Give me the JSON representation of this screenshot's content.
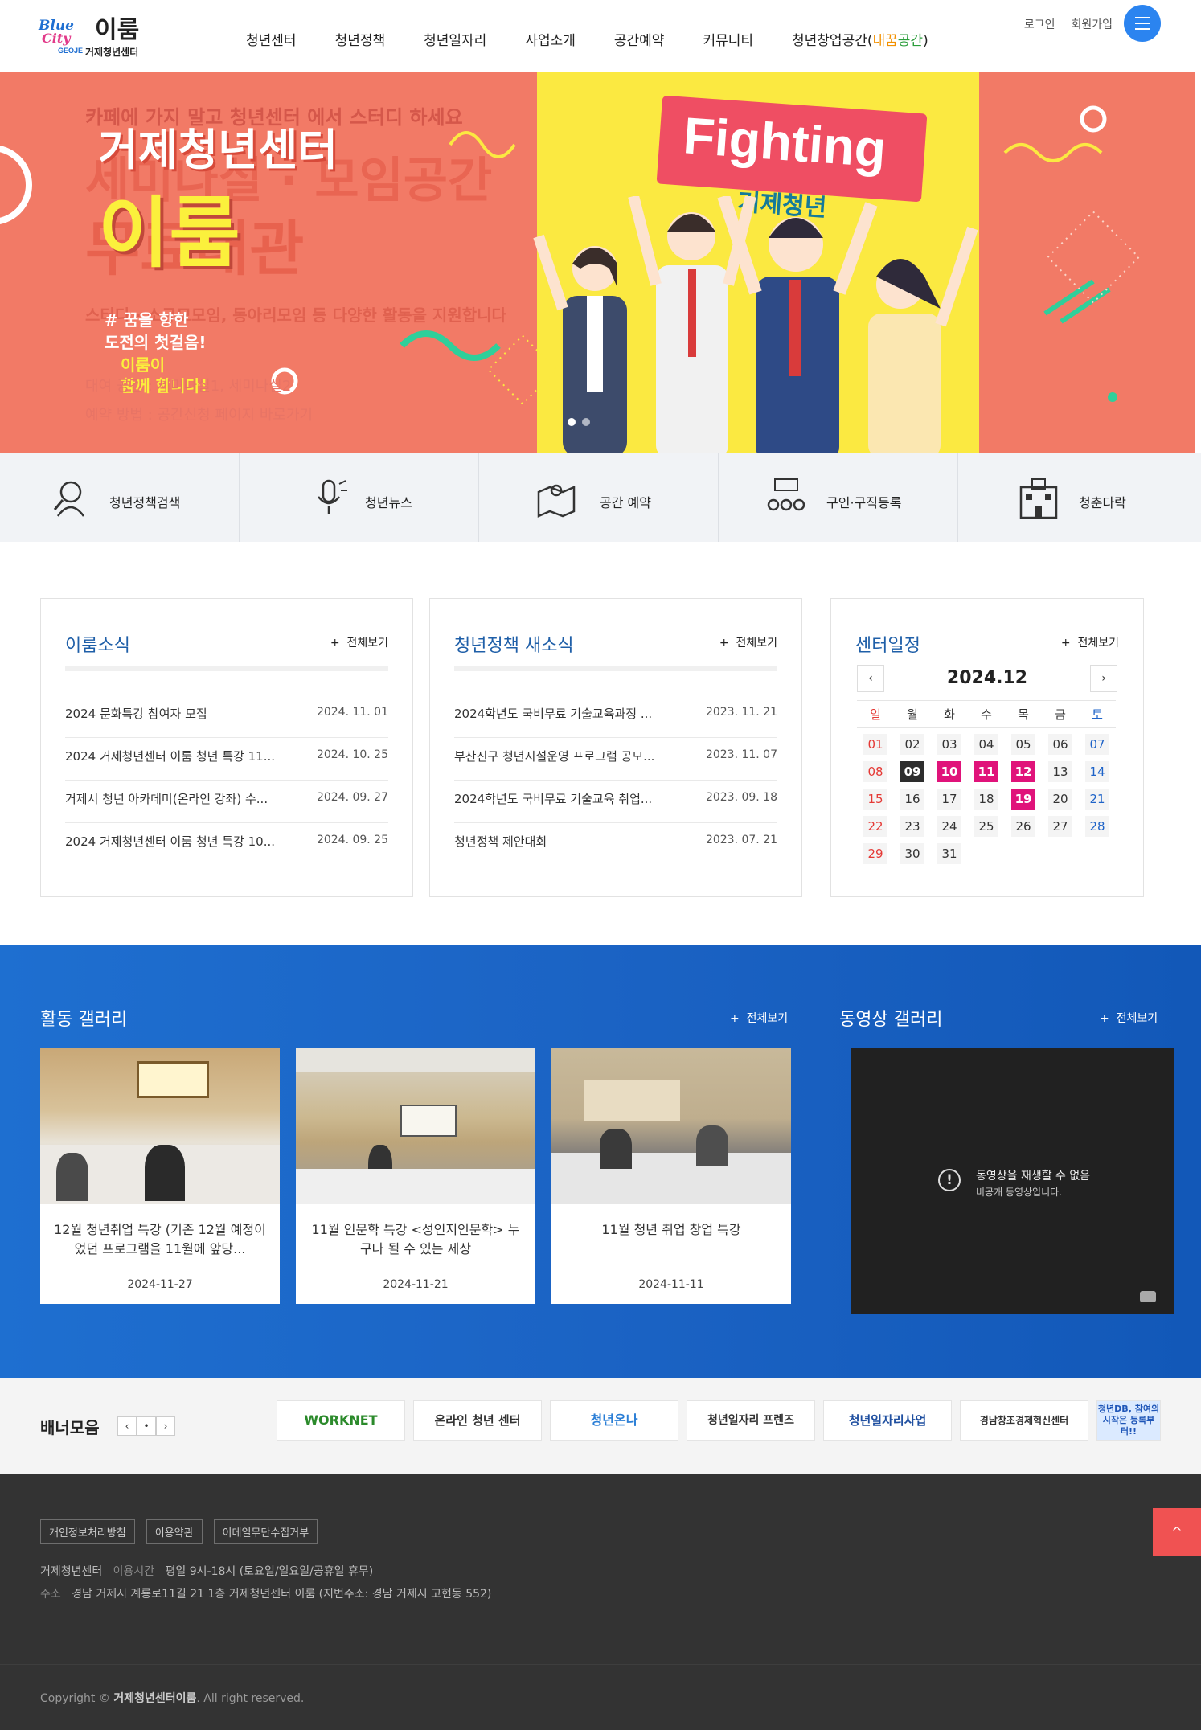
{
  "header": {
    "logo_blue": "Blue",
    "logo_city": "City",
    "logo_geoje": "GEOJE",
    "logo_main": "이룸",
    "logo_sub": "거제청년센터",
    "nav": [
      "청년센터",
      "청년정책",
      "청년일자리",
      "사업소개",
      "공간예약",
      "커뮤니티"
    ],
    "nav_last_prefix": "청년창업공간(",
    "nav_last_hl1": "내꿈",
    "nav_last_hl2": "공간",
    "nav_last_suffix": ")",
    "login": "로그인",
    "join": "회원가입",
    "menu_icon": "hamburger-icon"
  },
  "hero": {
    "ghost_line1": "카페에 가지 말고 청년센터 에서 스터디 하세요",
    "ghost_line2": "세미나실 · 모임공간",
    "ghost_line3": "무료대관",
    "title": "거제청년센터",
    "name": "이룸",
    "ghost_line4": "스터디 · 소규모모임, 동아리모임 등 다양한 활동을 지원합니다",
    "slogan1": "# 꿈을 향한",
    "slogan2": "도전의 첫걸음!",
    "slogan3": "이룸이",
    "slogan4": "함께 합니다!",
    "ghost_line5": "대여 공간 : 세미나실1, 세미나실2",
    "ghost_line6": "예약 방법 : 공간신청 페이지 바로가기",
    "fighting": "Fighting",
    "fighting_sub": "거제청년",
    "colors": {
      "bg": "#f27a66",
      "yellow": "#fbe941"
    }
  },
  "quick_menu": [
    {
      "label": "청년정책검색",
      "icon": "search-person-icon"
    },
    {
      "label": "청년뉴스",
      "icon": "microphone-icon"
    },
    {
      "label": "공간 예약",
      "icon": "map-location-icon"
    },
    {
      "label": "구인·구직등록",
      "icon": "job-people-icon"
    },
    {
      "label": "청춘다락",
      "icon": "building-icon"
    }
  ],
  "iroom_news": {
    "title": "이룸소식",
    "more": "전체보기",
    "posts": [
      {
        "title": "2024 문화특강 참여자 모집",
        "date": "2024. 11. 01"
      },
      {
        "title": "2024 거제청년센터 이룸 청년 특강 11...",
        "date": "2024. 10. 25"
      },
      {
        "title": "거제시 청년 아카데미(온라인 강좌) 수...",
        "date": "2024. 09. 27"
      },
      {
        "title": "2024 거제청년센터 이룸 청년 특강 10...",
        "date": "2024. 09. 25"
      }
    ]
  },
  "policy_news": {
    "title": "청년정책 새소식",
    "more": "전체보기",
    "posts": [
      {
        "title": "2024학년도 국비무료 기술교육과정 ...",
        "date": "2023. 11. 21"
      },
      {
        "title": "부산진구 청년시설운영 프로그램 공모...",
        "date": "2023. 11. 07"
      },
      {
        "title": "2024학년도 국비무료 기술교육 취업...",
        "date": "2023. 09. 18"
      },
      {
        "title": "청년정책 제안대회",
        "date": "2023. 07. 21"
      }
    ]
  },
  "calendar": {
    "title": "센터일정",
    "more": "전체보기",
    "month": "2024.12",
    "prev": "‹",
    "next": "›",
    "weekdays": [
      "일",
      "월",
      "화",
      "수",
      "목",
      "금",
      "토"
    ],
    "weeks": [
      [
        "01",
        "02",
        "03",
        "04",
        "05",
        "06",
        "07"
      ],
      [
        "08",
        "09",
        "10",
        "11",
        "12",
        "13",
        "14"
      ],
      [
        "15",
        "16",
        "17",
        "18",
        "19",
        "20",
        "21"
      ],
      [
        "22",
        "23",
        "24",
        "25",
        "26",
        "27",
        "28"
      ],
      [
        "29",
        "30",
        "31",
        "",
        "",
        "",
        ""
      ]
    ],
    "today": "09",
    "event_days": [
      "10",
      "11",
      "12",
      "19"
    ]
  },
  "activity_gallery": {
    "title": "활동 갤러리",
    "more": "전체보기",
    "items": [
      {
        "title": "12월 청년취업 특강 (기존 12월 예정이었던 프로그램을 11월에 앞당...",
        "date": "2024-11-27"
      },
      {
        "title": "11월 인문학 특강 <성인지인문학> 누구나 될 수 있는 세상",
        "date": "2024-11-21"
      },
      {
        "title": "11월 청년 취업 창업 특강",
        "date": "2024-11-11"
      }
    ]
  },
  "video_gallery": {
    "title": "동영상 갤러리",
    "more": "전체보기",
    "error_icon": "!",
    "error_title": "동영상을 재생할 수 없음",
    "error_sub": "비공개 동영상입니다."
  },
  "banners": {
    "title": "배너모음",
    "prev": "‹",
    "pause": "•",
    "next": "›",
    "items": [
      "WORKNET",
      "온라인 청년 센터",
      "청년온나",
      "청년일자리 프렌즈",
      "청년일자리사업",
      "경남창조경제혁신센터",
      "청년DB, 참여의 시작은 등록부터!!"
    ]
  },
  "footer": {
    "links": [
      "개인정보처리방침",
      "이용약관",
      "이메일무단수집거부"
    ],
    "org": "거제청년센터",
    "hours_label": "이용시간",
    "hours": "평일 9시-18시 (토요일/일요일/공휴일 휴무)",
    "addr_label": "주소",
    "addr": "경남 거제시 계룡로11길 21 1층 거제청년센터 이룸 (지번주소: 경남 거제시 고현동 552)",
    "copy_prefix": "Copyright © ",
    "copy_name": "거제청년센터이룸",
    "copy_suffix": ". All right reserved.",
    "top": "^"
  }
}
